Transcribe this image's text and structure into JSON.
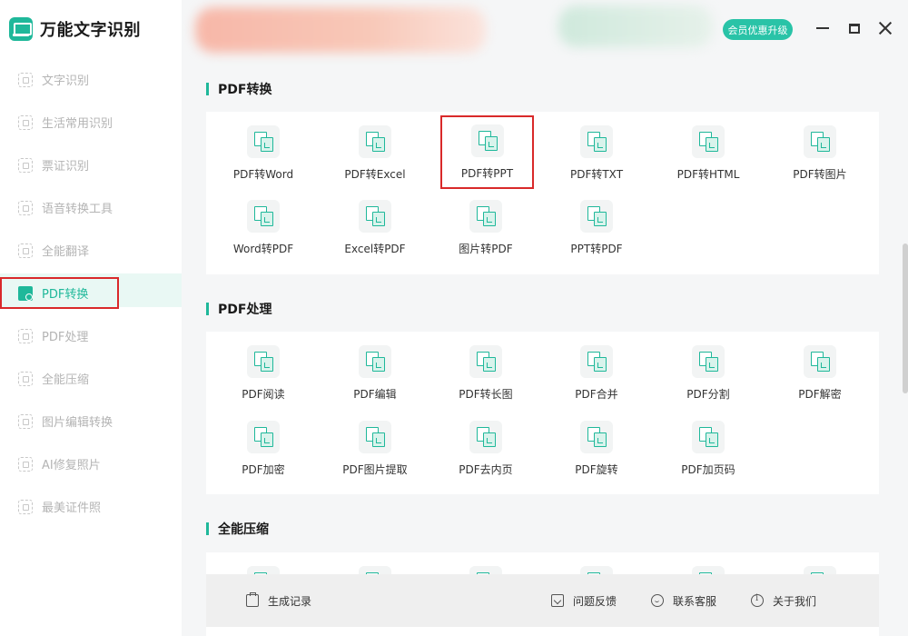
{
  "app": {
    "title": "万能文字识别"
  },
  "header": {
    "vip_label": "会员优惠升级"
  },
  "sidebar": {
    "items": [
      {
        "label": "文字识别",
        "icon": "scan-text-icon"
      },
      {
        "label": "生活常用识别",
        "icon": "scan-life-icon"
      },
      {
        "label": "票证识别",
        "icon": "scan-ticket-icon"
      },
      {
        "label": "语音转换工具",
        "icon": "audio-convert-icon"
      },
      {
        "label": "全能翻译",
        "icon": "translate-icon"
      },
      {
        "label": "PDF转换",
        "icon": "pdf-convert-icon",
        "active": true
      },
      {
        "label": "PDF处理",
        "icon": "pdf-process-icon"
      },
      {
        "label": "全能压缩",
        "icon": "compress-icon"
      },
      {
        "label": "图片编辑转换",
        "icon": "image-edit-icon"
      },
      {
        "label": "AI修复照片",
        "icon": "ai-repair-icon"
      },
      {
        "label": "最美证件照",
        "icon": "id-photo-icon"
      }
    ]
  },
  "sections": {
    "pdf_convert": {
      "title": "PDF转换",
      "tools": [
        "PDF转Word",
        "PDF转Excel",
        "PDF转PPT",
        "PDF转TXT",
        "PDF转HTML",
        "PDF转图片",
        "Word转PDF",
        "Excel转PDF",
        "图片转PDF",
        "PPT转PDF"
      ]
    },
    "pdf_process": {
      "title": "PDF处理",
      "tools": [
        "PDF阅读",
        "PDF编辑",
        "PDF转长图",
        "PDF合并",
        "PDF分割",
        "PDF解密",
        "PDF加密",
        "PDF图片提取",
        "PDF去内页",
        "PDF旋转",
        "PDF加页码"
      ]
    },
    "compress": {
      "title": "全能压缩"
    }
  },
  "footer": {
    "history": "生成记录",
    "feedback": "问题反馈",
    "support": "联系客服",
    "about": "关于我们"
  },
  "colors": {
    "accent": "#1fb89a",
    "highlight_border": "#d9292a",
    "vip": "#29c3a7"
  }
}
